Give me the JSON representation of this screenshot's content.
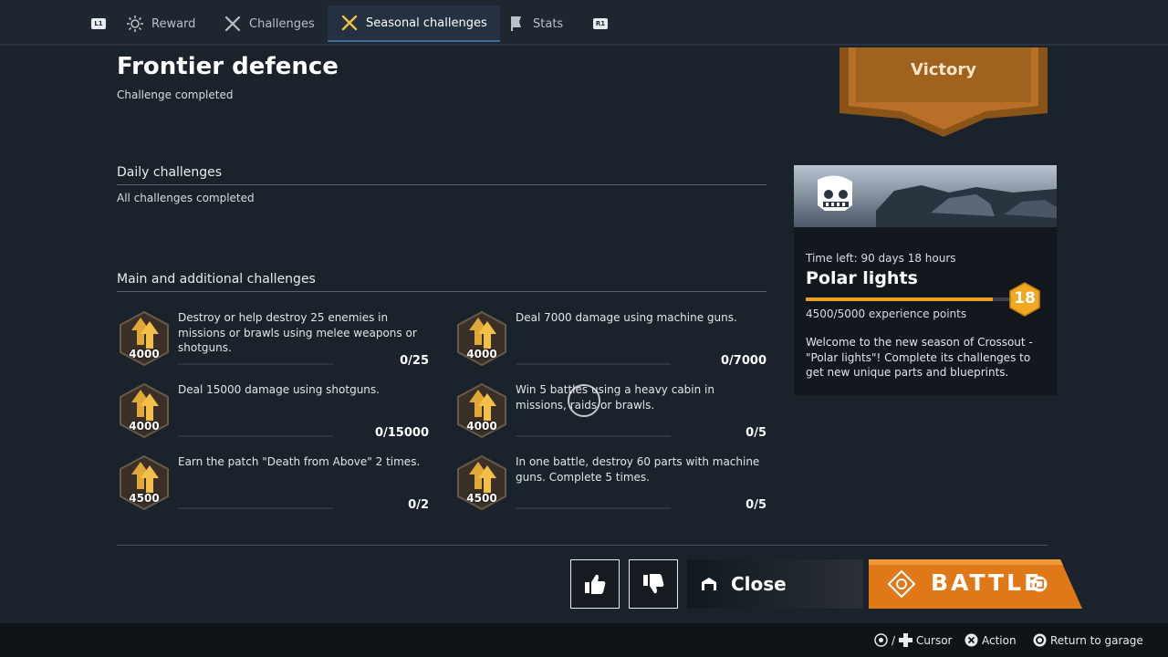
{
  "tabs": [
    {
      "label": "Reward",
      "icon": "sun-icon"
    },
    {
      "label": "Challenges",
      "icon": "crossed-swords-icon"
    },
    {
      "label": "Seasonal challenges",
      "icon": "crossed-swords-icon",
      "active": true
    },
    {
      "label": "Stats",
      "icon": "banner-icon"
    }
  ],
  "shoulder_hints": {
    "left": "L1",
    "right": "R1"
  },
  "page": {
    "title": "Frontier defence",
    "subtitle": "Challenge completed"
  },
  "daily": {
    "heading": "Daily challenges",
    "status": "All challenges completed"
  },
  "main": {
    "heading": "Main and additional challenges",
    "challenges": [
      {
        "reward": "4000",
        "text": "Destroy or help destroy 25 enemies in missions or brawls using melee weapons or shotguns.",
        "progress": "0/25"
      },
      {
        "reward": "4000",
        "text": "Deal 7000 damage using machine guns.",
        "progress": "0/7000"
      },
      {
        "reward": "4000",
        "text": "Deal 15000 damage using shotguns.",
        "progress": "0/15000"
      },
      {
        "reward": "4000",
        "text": "Win 5 battles using a heavy cabin in missions, raids or brawls.",
        "progress": "0/5"
      },
      {
        "reward": "4500",
        "text": "Earn the patch \"Death from Above\" 2 times.",
        "progress": "0/2"
      },
      {
        "reward": "4500",
        "text": "In one battle, destroy 60 parts with machine guns. Complete 5 times.",
        "progress": "0/5"
      }
    ]
  },
  "victory": {
    "label": "Victory"
  },
  "season": {
    "time_left": "Time left: 90 days 18 hours",
    "name": "Polar lights",
    "level": "18",
    "xp_text": "4500/5000 experience points",
    "xp_fraction": 0.9,
    "welcome": "Welcome to the new season of Crossout - \"Polar lights\"! Complete its challenges to get new unique parts and blueprints."
  },
  "actions": {
    "close_label": "Close",
    "battle_label": "BATTLE"
  },
  "hints": [
    {
      "label": "Cursor",
      "icon": "dpad-icon"
    },
    {
      "label": "Action",
      "icon": "cross-button-icon"
    },
    {
      "label": "Return to garage",
      "icon": "circle-button-icon"
    }
  ],
  "colors": {
    "accent": "#f0a020",
    "battle": "#e07818",
    "background": "#1a222b"
  }
}
